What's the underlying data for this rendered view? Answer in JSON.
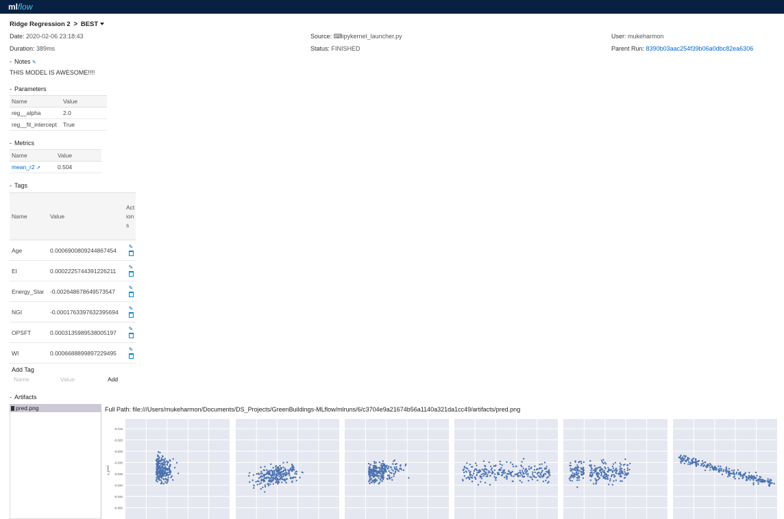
{
  "brand": {
    "ml": "ml",
    "flow": "flow"
  },
  "run": {
    "name": "Ridge Regression 2",
    "chevron": ">",
    "badge": "BEST",
    "date_label": "Date:",
    "date": "2020-02-06 23:18:43",
    "duration_label": "Duration:",
    "duration": "389ms",
    "source_label": "Source:",
    "source": "ipykernel_launcher.py",
    "status_label": "Status:",
    "status": "FINISHED",
    "user_label": "User:",
    "user": "mukeharmon",
    "parent_label": "Parent Run:",
    "parent": "8390b03aac254f39b06a0dbc82ea6306"
  },
  "notes": {
    "title": "Notes",
    "text": "THIS MODEL IS AWESOME!!!!"
  },
  "parameters": {
    "title": "Parameters",
    "headers": [
      "Name",
      "Value"
    ],
    "rows": [
      {
        "name": "reg__alpha",
        "value": "2.0"
      },
      {
        "name": "reg__fit_intercept",
        "value": "True"
      }
    ]
  },
  "metrics": {
    "title": "Metrics",
    "headers": [
      "Name",
      "Value"
    ],
    "rows": [
      {
        "name": "mean_r2",
        "value": "0.504"
      }
    ]
  },
  "tags": {
    "title": "Tags",
    "headers": [
      "Name",
      "Value",
      "Actions"
    ],
    "rows": [
      {
        "name": "Age",
        "value": "0.0006900809244867454"
      },
      {
        "name": "EI",
        "value": "0.0002225744391226211"
      },
      {
        "name": "Energy_Star",
        "value": "-0.002648678649573547"
      },
      {
        "name": "NGI",
        "value": "-0.0001763397632395694"
      },
      {
        "name": "OPSFT",
        "value": "0.0003135989538005197"
      },
      {
        "name": "WI",
        "value": "0.0006688899897229495"
      }
    ],
    "add_title": "Add Tag",
    "name_placeholder": "Name",
    "value_placeholder": "Value",
    "add_button": "Add"
  },
  "artifacts": {
    "title": "Artifacts",
    "file": "pred.png",
    "full_path_label": "Full Path:",
    "full_path": "file:///Users/mukeharmon/Documents/DS_Projects/GreenBuildings-MLflow/mlruns/6/c3704e9a21674b56a1140a321da1cc49/artifacts/pred.png"
  },
  "plot": {
    "ylabel": "y_pred",
    "yticks": [
      "-0.015",
      "-0.020",
      "-0.025",
      "-0.030",
      "-0.035",
      "-0.040",
      "-0.045",
      "-0.050"
    ],
    "point_color": "#4c72b0",
    "panel_bg": "#e5e8f0"
  }
}
